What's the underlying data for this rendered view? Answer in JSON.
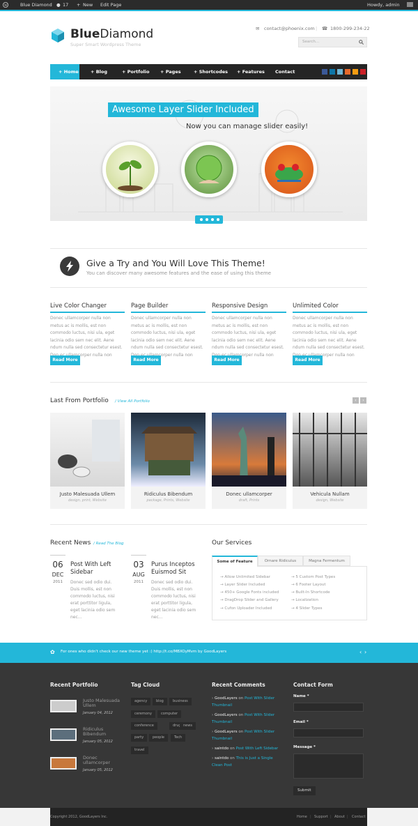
{
  "admin_bar": {
    "site_name": "Blue Diamond",
    "comments_count": "17",
    "new_label": "New",
    "edit_label": "Edit Page",
    "howdy": "Howdy, admin"
  },
  "header": {
    "logo_bold": "Blue",
    "logo_light": "Diamond",
    "tagline": "Super Smart Wordpress Theme",
    "email": "contact@phoenix.com",
    "phone": "1800-299-234-22",
    "search_placeholder": "Search..."
  },
  "nav": {
    "items": [
      "+ Home",
      "+ Blog",
      "+ Portfolio",
      "+ Pages",
      "+ Shortcodes",
      "+ Features",
      "Contact"
    ],
    "social_icons": [
      "facebook-icon",
      "linkedin-icon",
      "stumbleupon-icon",
      "digg-icon",
      "rss-icon",
      "pinterest-icon"
    ]
  },
  "slider": {
    "title": "Awesome Layer Slider Included",
    "subtitle": "Now you can manage slider easily!"
  },
  "try": {
    "title": "Give a Try and You Will Love This Theme!",
    "subtitle": "You can discover many awesome features and the ease of using this theme"
  },
  "features": [
    {
      "title": "Live Color Changer",
      "text": "Donec ullamcorper nulla non metus ac is mollis, est non commodo luctus, nisi ula, eget lacinia odio sem nec elit. Aene ndum nulla sed consectetur esest. Don ec ullamcorper nulla non metu.",
      "button": "Read More"
    },
    {
      "title": "Page Builder",
      "text": "Donec ullamcorper nulla non metus ac is mollis, est non commodo luctus, nisi ula, eget lacinia odio sem nec elit. Aene ndum nulla sed consectetur esest. Don ec ullamcorper nulla non metu.",
      "button": "Read More"
    },
    {
      "title": "Responsive Design",
      "text": "Donec ullamcorper nulla non metus ac is mollis, est non commodo luctus, nisi ula, eget lacinia odio sem nec elit. Aene ndum nulla sed consectetur esest. Don ec ullamcorper nulla non metu.",
      "button": "Read More"
    },
    {
      "title": "Unlimited Color",
      "text": "Donec ullamcorper nulla non metus ac is mollis, est non commodo luctus, nisi ula, eget lacinia odio sem nec elit. Aene ndum nulla sed consectetur esest. Don ec ullamcorper nulla non metu.",
      "button": "Read More"
    }
  ],
  "portfolio": {
    "title": "Last From Portfolio",
    "link": "/ View All Portfolio",
    "items": [
      {
        "title": "Justo Malesuada Ullem",
        "tags": "design, print, Website"
      },
      {
        "title": "Ridiculus Bibendum",
        "tags": "package, Prints, Website"
      },
      {
        "title": "Donec ullamcorper",
        "tags": "draft, Prints"
      },
      {
        "title": "Vehicula Nullam",
        "tags": "design, Website"
      }
    ]
  },
  "news": {
    "title": "Recent News",
    "link": "/ Read The Blog",
    "items": [
      {
        "day": "06",
        "month": "DEC",
        "year": "2011",
        "title": "Post With Left Sidebar",
        "text": "Donec sed odio dui. Duis mollis, est non commodo luctus, nisi erat porttitor ligula, eget lacinia odio sem nec..."
      },
      {
        "day": "03",
        "month": "AUG",
        "year": "2011",
        "title": "Purus Inceptos Euismod Sit",
        "text": "Donec sed odio dui. Duis mollis, est non commodo luctus, nisi erat porttitor ligula, eget lacinia odio sem nec..."
      }
    ]
  },
  "services": {
    "title": "Our Services",
    "tabs": [
      "Some of Feature",
      "Ornare Ridiculus",
      "Magna Fermentum"
    ],
    "left": [
      "Allow Unlimited Sidebar",
      "Layer Slider Included",
      "450+ Google Fonts included",
      "DragDrop Slider and Gallery",
      "Cufon Uploader Included"
    ],
    "right": [
      "5 Custom Post Types",
      "6 Footer Layout",
      "Built-In Shortcode",
      "Localization",
      "4 Slider Types"
    ]
  },
  "twitter": {
    "text": "For ones who didn't check our new theme yet :) http://t.co/MBXOyMvm by GoodLayers"
  },
  "footer": {
    "recent_portfolio_title": "Recent Portfolio",
    "recent_portfolio": [
      {
        "title": "Justo Malesuada Ullem",
        "date": "January 04, 2012"
      },
      {
        "title": "Ridiculus Bibendum",
        "date": "January 05, 2012"
      },
      {
        "title": "Donec ullamcorper",
        "date": "January 05, 2012"
      }
    ],
    "tag_cloud_title": "Tag Cloud",
    "tags": [
      "agency",
      "blog",
      "business",
      "ceremony",
      "computer",
      "conference",
      "drugs",
      "news",
      "party",
      "people",
      "Tech",
      "travel"
    ],
    "recent_comments_title": "Recent Comments",
    "comments": [
      {
        "author": "GoodLayers",
        "on": " on ",
        "post": "Post With Slider Thumbnail"
      },
      {
        "author": "GoodLayers",
        "on": " on ",
        "post": "Post With Slider Thumbnail"
      },
      {
        "author": "GoodLayers",
        "on": " on ",
        "post": "Post With Slider Thumbnail"
      },
      {
        "author": "saintdo",
        "on": " on ",
        "post": "Post With Left Sidebar"
      },
      {
        "author": "saintdo",
        "on": " on ",
        "post": "This is Just a Single Clean Post"
      }
    ],
    "contact_title": "Contact Form",
    "name_label": "Name *",
    "email_label": "Email *",
    "message_label": "Message *",
    "submit_label": "Submit"
  },
  "copyright": {
    "text": "Copyright 2012, GoodLayers Inc.",
    "links": [
      "Home",
      "Support",
      "About",
      "Contact"
    ]
  },
  "colors": {
    "accent": "#23b7d9",
    "dark": "#252525",
    "footer": "#373737"
  }
}
